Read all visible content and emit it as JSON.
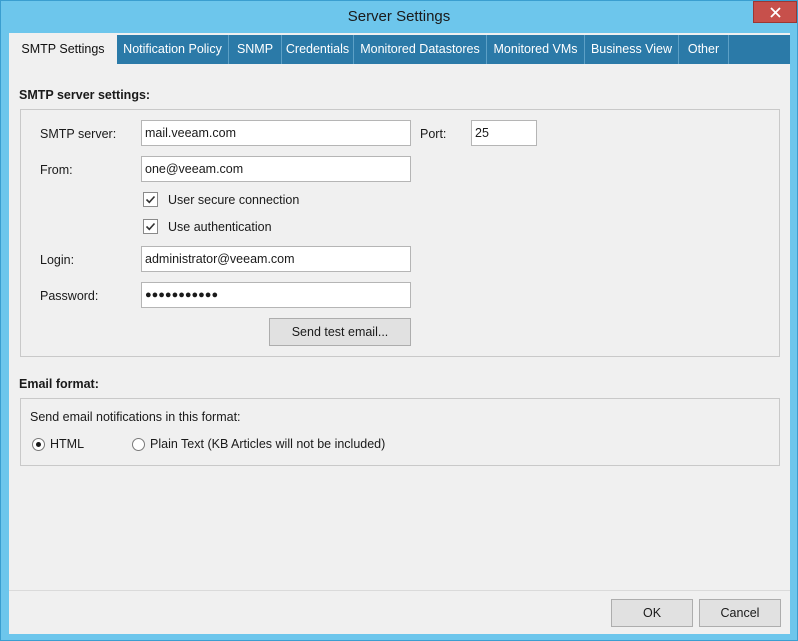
{
  "window": {
    "title": "Server Settings",
    "close_icon": "close-icon"
  },
  "tabs": [
    {
      "label": "SMTP Settings",
      "active": true
    },
    {
      "label": "Notification Policy"
    },
    {
      "label": "SNMP"
    },
    {
      "label": "Credentials"
    },
    {
      "label": "Monitored Datastores"
    },
    {
      "label": "Monitored VMs"
    },
    {
      "label": "Business View"
    },
    {
      "label": "Other"
    }
  ],
  "smtp": {
    "heading": "SMTP server settings:",
    "server_label": "SMTP server:",
    "server_value": "mail.veeam.com",
    "port_label": "Port:",
    "port_value": "25",
    "from_label": "From:",
    "from_value": "one@veeam.com",
    "secure_label": "User secure connection",
    "secure_checked": true,
    "auth_label": "Use authentication",
    "auth_checked": true,
    "login_label": "Login:",
    "login_value": "administrator@veeam.com",
    "password_label": "Password:",
    "password_value": "●●●●●●●●●●●",
    "test_button": "Send test email..."
  },
  "email_format": {
    "heading": "Email format:",
    "prompt": "Send email notifications in this format:",
    "html_label": "HTML",
    "html_selected": true,
    "plain_label": "Plain Text (KB Articles will not be included)"
  },
  "footer": {
    "ok_label": "OK",
    "cancel_label": "Cancel"
  },
  "colors": {
    "titlebar": "#6dc6ec",
    "tabstrip": "#2b7aa8",
    "close": "#c7504b"
  }
}
